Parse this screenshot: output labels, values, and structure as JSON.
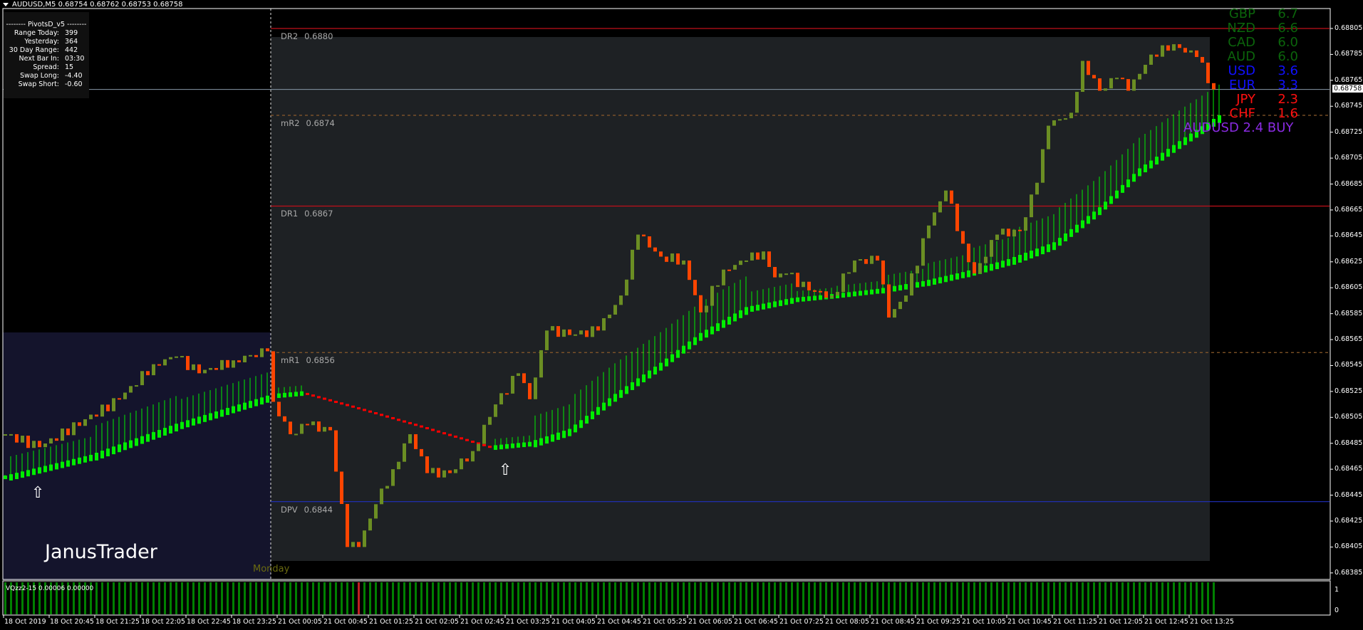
{
  "window": {
    "title": "AUDUSD,M5  0.68754 0.68762 0.68753 0.68758"
  },
  "info_panel": {
    "header": "--------  PivotsD_v5  --------",
    "rows": [
      {
        "label": "Range  Today:",
        "value": "399"
      },
      {
        "label": "Yesterday:",
        "value": "364"
      },
      {
        "label": "30 Day Range:",
        "value": "442"
      },
      {
        "label": "Next Bar In:",
        "value": "03:30"
      },
      {
        "label": "Spread:",
        "value": "15"
      },
      {
        "label": "Swap  Long:",
        "value": "-4.40"
      },
      {
        "label": "Swap  Short:",
        "value": "-0.60"
      }
    ]
  },
  "levels": [
    {
      "name": "DR2",
      "value": "0.6880",
      "price": 0.68805,
      "color": "#c0101a",
      "style": "solid"
    },
    {
      "name": "mR2",
      "value": "0.6874",
      "price": 0.68738,
      "color": "#8a5a2a",
      "style": "dashed"
    },
    {
      "name": "DR1",
      "value": "0.6867",
      "price": 0.68668,
      "color": "#c0101a",
      "style": "solid"
    },
    {
      "name": "mR1",
      "value": "0.6856",
      "price": 0.68555,
      "color": "#8a5a2a",
      "style": "dashed"
    },
    {
      "name": "DPV",
      "value": "0.6844",
      "price": 0.6844,
      "color": "#2030c0",
      "style": "solid"
    }
  ],
  "current_price": {
    "label": "0.68758",
    "price": 0.68758
  },
  "currency_strength": [
    {
      "name": "GBP",
      "value": "6.7",
      "color": "#0b640b"
    },
    {
      "name": "NZD",
      "value": "6.6",
      "color": "#0b640b"
    },
    {
      "name": "CAD",
      "value": "6.0",
      "color": "#0b640b"
    },
    {
      "name": "AUD",
      "value": "6.0",
      "color": "#0b640b"
    },
    {
      "name": "USD",
      "value": "3.6",
      "color": "#1010ff"
    },
    {
      "name": "EUR",
      "value": "3.3",
      "color": "#1010ff"
    },
    {
      "name": "JPY",
      "value": "2.3",
      "color": "#ff1010"
    },
    {
      "name": "CHF",
      "value": "1.6",
      "color": "#ff1010"
    }
  ],
  "signal": "AUDUSD 2.4 BUY",
  "brand": "JanusTrader",
  "session_label": "Monday",
  "indicator": {
    "label": "VQzz2-15 0.00006 0.00000",
    "scale": [
      "1",
      "0"
    ],
    "red_bar_index": 62
  },
  "price_axis": [
    "0.68805",
    "0.68785",
    "0.68765",
    "0.68745",
    "0.68725",
    "0.68705",
    "0.68685",
    "0.68665",
    "0.68645",
    "0.68625",
    "0.68605",
    "0.68585",
    "0.68565",
    "0.68545",
    "0.68525",
    "0.68505",
    "0.68485",
    "0.68465",
    "0.68445",
    "0.68425",
    "0.68405",
    "0.68385"
  ],
  "time_axis": [
    "18 Oct 2019",
    "18 Oct 20:45",
    "18 Oct 21:25",
    "18 Oct 22:05",
    "18 Oct 22:45",
    "18 Oct 23:25",
    "21 Oct 00:05",
    "21 Oct 00:45",
    "21 Oct 01:25",
    "21 Oct 02:05",
    "21 Oct 02:45",
    "21 Oct 03:25",
    "21 Oct 04:05",
    "21 Oct 04:45",
    "21 Oct 05:25",
    "21 Oct 06:05",
    "21 Oct 06:45",
    "21 Oct 07:25",
    "21 Oct 08:05",
    "21 Oct 08:45",
    "21 Oct 09:25",
    "21 Oct 10:05",
    "21 Oct 10:45",
    "21 Oct 11:25",
    "21 Oct 12:05",
    "21 Oct 12:45",
    "21 Oct 13:25"
  ],
  "colors": {
    "bull": "#6b8e23",
    "bear": "#ff4500",
    "ma_up": "#00ee00",
    "ma_down": "#ff0000",
    "hist": "#008000",
    "hist_alt": "#c02020"
  },
  "price_closes": [
    [
      0,
      0.68492
    ],
    [
      6,
      0.68482
    ],
    [
      20,
      0.68519
    ],
    [
      26,
      0.68546
    ],
    [
      30,
      0.68552
    ],
    [
      34,
      0.68539
    ],
    [
      40,
      0.68549
    ],
    [
      46,
      0.68556
    ],
    [
      47,
      0.68517
    ],
    [
      50,
      0.68492
    ],
    [
      53,
      0.68499
    ],
    [
      57,
      0.68495
    ],
    [
      60,
      0.68405
    ],
    [
      62,
      0.68405
    ],
    [
      65,
      0.68438
    ],
    [
      68,
      0.68465
    ],
    [
      71,
      0.68492
    ],
    [
      74,
      0.68462
    ],
    [
      78,
      0.68462
    ],
    [
      82,
      0.68479
    ],
    [
      86,
      0.68515
    ],
    [
      90,
      0.68539
    ],
    [
      92,
      0.68519
    ],
    [
      95,
      0.68572
    ],
    [
      100,
      0.68569
    ],
    [
      104,
      0.68572
    ],
    [
      108,
      0.68599
    ],
    [
      111,
      0.68646
    ],
    [
      115,
      0.68629
    ],
    [
      119,
      0.68626
    ],
    [
      122,
      0.68586
    ],
    [
      126,
      0.68619
    ],
    [
      130,
      0.68626
    ],
    [
      133,
      0.68633
    ],
    [
      135,
      0.68613
    ],
    [
      137,
      0.68616
    ],
    [
      141,
      0.68603
    ],
    [
      145,
      0.68599
    ],
    [
      149,
      0.68626
    ],
    [
      153,
      0.68626
    ],
    [
      155,
      0.68582
    ],
    [
      158,
      0.68599
    ],
    [
      162,
      0.68653
    ],
    [
      165,
      0.6868
    ],
    [
      168,
      0.68639
    ],
    [
      170,
      0.68616
    ],
    [
      174,
      0.68646
    ],
    [
      178,
      0.68649
    ],
    [
      181,
      0.68686
    ],
    [
      183,
      0.6873
    ],
    [
      187,
      0.6874
    ],
    [
      189,
      0.6878
    ],
    [
      192,
      0.68757
    ],
    [
      195,
      0.68767
    ],
    [
      197,
      0.68757
    ],
    [
      200,
      0.68777
    ],
    [
      203,
      0.68792
    ],
    [
      206,
      0.6879
    ],
    [
      209,
      0.68783
    ],
    [
      212,
      0.68758
    ]
  ],
  "ma_points": [
    [
      0,
      0.68459
    ],
    [
      15,
      0.68475
    ],
    [
      30,
      0.68499
    ],
    [
      47,
      0.68522
    ],
    [
      52,
      0.68524
    ],
    [
      61,
      0.68513
    ],
    [
      72,
      0.68499
    ],
    [
      85,
      0.68482
    ],
    [
      92,
      0.68485
    ],
    [
      99,
      0.68495
    ],
    [
      107,
      0.68522
    ],
    [
      115,
      0.68546
    ],
    [
      122,
      0.68569
    ],
    [
      130,
      0.68589
    ],
    [
      138,
      0.68596
    ],
    [
      145,
      0.68599
    ],
    [
      153,
      0.68603
    ],
    [
      161,
      0.68609
    ],
    [
      168,
      0.68616
    ],
    [
      176,
      0.68626
    ],
    [
      184,
      0.68639
    ],
    [
      192,
      0.68666
    ],
    [
      199,
      0.68696
    ],
    [
      207,
      0.6872
    ],
    [
      213,
      0.68737
    ]
  ],
  "signal_arrows": [
    6,
    88
  ]
}
